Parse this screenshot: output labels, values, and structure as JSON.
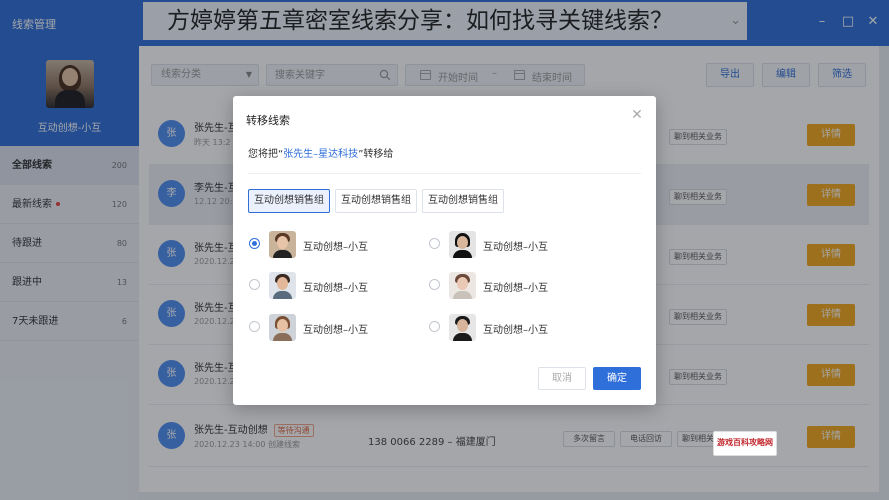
{
  "app": {
    "title": "线索管理",
    "headline": "方婷婷第五章密室线索分享：如何找寻关键线索？"
  },
  "window_controls": {
    "minimize": "–",
    "maximize": "□",
    "close": "✕"
  },
  "headline_caret": "⌄",
  "sidebar": {
    "profile_name": "互动创想-小互",
    "items": [
      {
        "label": "全部线索",
        "count": "200",
        "active": true
      },
      {
        "label": "最新线索",
        "count": "120",
        "dot": true
      },
      {
        "label": "待跟进",
        "count": "80"
      },
      {
        "label": "跟进中",
        "count": "13"
      },
      {
        "label": "7天未跟进",
        "count": "6"
      }
    ]
  },
  "toolbar": {
    "category_placeholder": "线索分类",
    "search_placeholder": "搜索关键字",
    "start_date": "开始时间",
    "date_separator": "–",
    "end_date": "结束时间",
    "export_label": "导出",
    "edit_label": "编辑",
    "filter_label": "筛选"
  },
  "rows": [
    {
      "avatar": "张",
      "name": "张先生-互",
      "time": "昨天 13:2"
    },
    {
      "avatar": "李",
      "name": "李先生-互",
      "time": "12.12 20:"
    },
    {
      "avatar": "张",
      "name": "张先生-互",
      "time": "2020.12.2"
    },
    {
      "avatar": "张",
      "name": "张先生-互",
      "time": "2020.12.2"
    },
    {
      "avatar": "张",
      "name": "张先生-互",
      "time": "2020.12.2"
    },
    {
      "avatar": "张",
      "name": "张先生-互动创想",
      "time": "2020.12.23 14:00 创建线索",
      "status": "等待沟通",
      "phone": "138 0066 2289 – 福建厦门"
    }
  ],
  "row_actions": {
    "multi_msg": "多次留言",
    "callback": "电话回访",
    "chat": "聊到相关业务",
    "detail": "详情"
  },
  "modal": {
    "title": "转移线索",
    "close": "✕",
    "msg_prefix": "您将把“",
    "msg_target": "张先生–星达科技",
    "msg_suffix": "”转移给",
    "groups": [
      "互动创想销售组",
      "互动创想销售组",
      "互动创想销售组"
    ],
    "members": [
      {
        "name": "互动创想–小互",
        "selected": true
      },
      {
        "name": "互动创想–小互"
      },
      {
        "name": "互动创想–小互"
      },
      {
        "name": "互动创想–小互"
      },
      {
        "name": "互动创想–小互"
      },
      {
        "name": "互动创想–小互"
      }
    ],
    "cancel_label": "取消",
    "confirm_label": "确定"
  },
  "watermark": {
    "text": "游戏百科攻略网"
  },
  "colors": {
    "primary": "#2f6fd9",
    "accent": "#f4a91d",
    "avatar": "#4f8ef2",
    "tag": "#e2653e"
  }
}
